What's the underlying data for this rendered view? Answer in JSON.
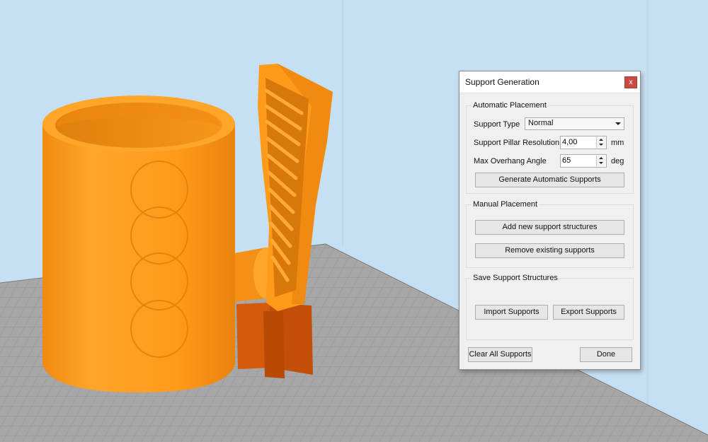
{
  "dialog": {
    "title": "Support Generation",
    "close_label": "x",
    "automatic": {
      "title": "Automatic Placement",
      "support_type_label": "Support Type",
      "support_type_value": "Normal",
      "pillar_label": "Support Pillar Resolution",
      "pillar_value": "4,00",
      "pillar_unit": "mm",
      "overhang_label": "Max Overhang Angle",
      "overhang_value": "65",
      "overhang_unit": "deg",
      "generate_label": "Generate Automatic Supports"
    },
    "manual": {
      "title": "Manual Placement",
      "add_label": "Add new support structures",
      "remove_label": "Remove existing supports"
    },
    "save": {
      "title": "Save Support Structures",
      "import_label": "Import Supports",
      "export_label": "Export Supports"
    },
    "clear_label": "Clear All Supports",
    "done_label": "Done"
  },
  "colors": {
    "background": "#c6e0f3",
    "build_plate": "#a7a7a7",
    "model": "#ff9a1a",
    "support": "#d65a0c"
  }
}
